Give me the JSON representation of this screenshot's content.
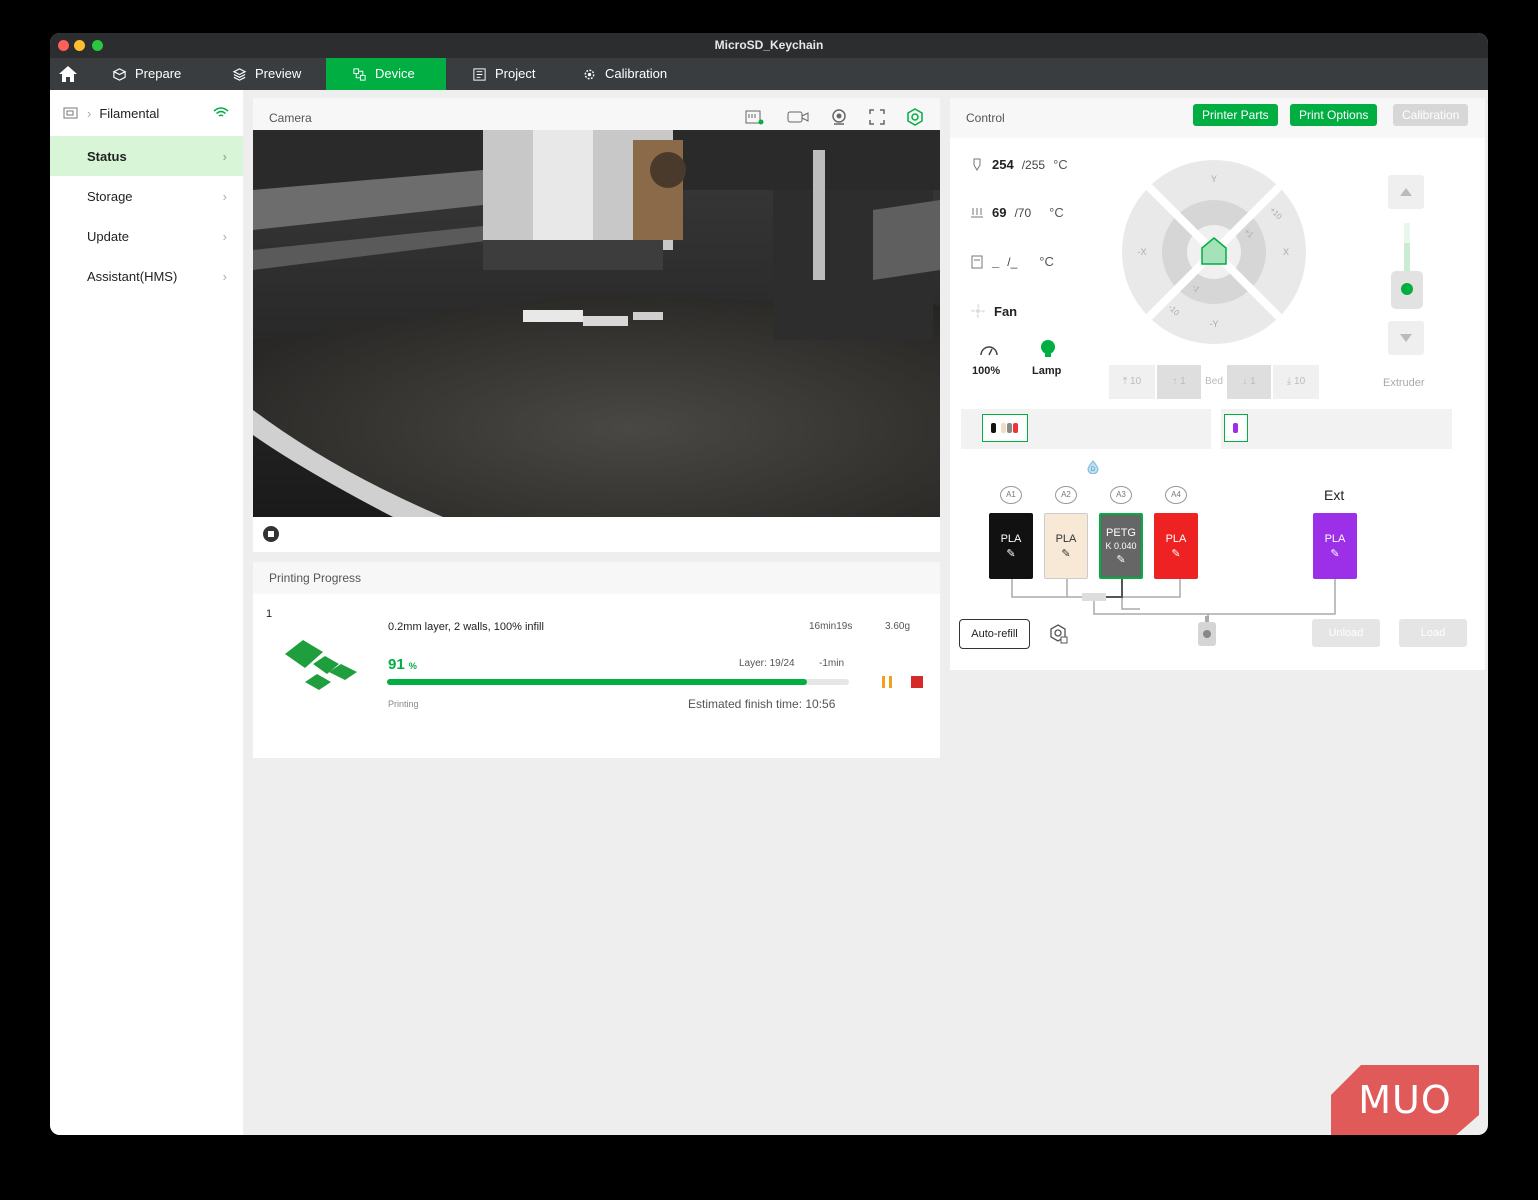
{
  "window": {
    "title": "MicroSD_Keychain"
  },
  "nav": {
    "tabs": [
      {
        "label": "Prepare",
        "icon": "cube-icon"
      },
      {
        "label": "Preview",
        "icon": "layers-icon"
      },
      {
        "label": "Device",
        "icon": "device-icon",
        "active": true
      },
      {
        "label": "Project",
        "icon": "document-icon"
      },
      {
        "label": "Calibration",
        "icon": "gear-icon"
      }
    ]
  },
  "sidebar": {
    "printer_name": "Filamental",
    "items": [
      {
        "label": "Status",
        "active": true
      },
      {
        "label": "Storage"
      },
      {
        "label": "Update"
      },
      {
        "label": "Assistant(HMS)"
      }
    ]
  },
  "camera": {
    "title": "Camera"
  },
  "progress": {
    "title": "Printing Progress",
    "plate": "1",
    "description": "0.2mm layer, 2 walls, 100% infill",
    "duration": "16min19s",
    "weight": "3.60g",
    "percent": "91",
    "percent_unit": "%",
    "percent_value": 0.91,
    "layer": "Layer: 19/24",
    "remaining": "-1min",
    "status": "Printing",
    "finish_time": "Estimated finish time: 10:56"
  },
  "control": {
    "title": "Control",
    "buttons": {
      "printer_parts": "Printer Parts",
      "print_options": "Print Options",
      "calibration": "Calibration"
    },
    "nozzle": {
      "current": "254",
      "target": "/255",
      "unit": "°C"
    },
    "bed": {
      "current": "69",
      "target": "/70",
      "unit": "°C"
    },
    "chamber": {
      "current": "_",
      "target": "/_",
      "unit": "°C"
    },
    "fan": {
      "label": "Fan",
      "speed": "100%"
    },
    "lamp": {
      "label": "Lamp"
    },
    "jog": {
      "y_plus": "Y",
      "y_minus": "-Y",
      "x_plus": "X",
      "x_minus": "-X",
      "plus10": "+10",
      "plus1": "+1",
      "minus1": "-1",
      "minus10": "-10"
    },
    "bed_buttons": {
      "up10": "10",
      "up1": "1",
      "label": "Bed",
      "down1": "1",
      "down10": "10"
    },
    "extruder_label": "Extruder",
    "ams": {
      "slots": [
        {
          "id": "A1",
          "material": "PLA",
          "k": "",
          "color": "#111111",
          "text": "#ffffff"
        },
        {
          "id": "A2",
          "material": "PLA",
          "k": "",
          "color": "#f8e9d6",
          "text": "#333333"
        },
        {
          "id": "A3",
          "material": "PETG",
          "k": "K 0.040",
          "color": "#666666",
          "text": "#ffffff"
        },
        {
          "id": "A4",
          "material": "PLA",
          "k": "",
          "color": "#ee2222",
          "text": "#ffffff"
        }
      ],
      "ext_label": "Ext",
      "ext_slot": {
        "material": "PLA",
        "color": "#9b30e8"
      },
      "auto_refill": "Auto-refill",
      "unload": "Unload",
      "load": "Load"
    }
  },
  "watermark": "MUO",
  "colors": {
    "accent": "#00ae42",
    "danger": "#d42a2a"
  }
}
